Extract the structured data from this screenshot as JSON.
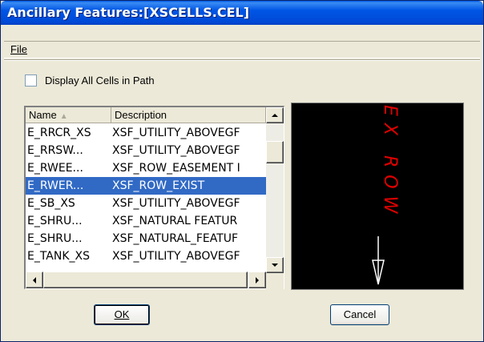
{
  "window": {
    "title": "Ancillary Features:[XSCELLS.CEL]"
  },
  "menu": {
    "file_label": "File"
  },
  "options": {
    "display_all_label": "Display All Cells in Path",
    "display_all_checked": false
  },
  "list": {
    "columns": [
      "Name",
      "Description"
    ],
    "sort_indicator": "▲",
    "rows": [
      {
        "name": "E_RRCR_XS",
        "desc": "XSF_UTILITY_ABOVEGF",
        "selected": false
      },
      {
        "name": "E_RRSW...",
        "desc": "XSF_UTILITY_ABOVEGF",
        "selected": false
      },
      {
        "name": "E_RWEE...",
        "desc": "XSF_ROW_EASEMENT I",
        "selected": false
      },
      {
        "name": "E_RWER...",
        "desc": "XSF_ROW_EXIST",
        "selected": true
      },
      {
        "name": "E_SB_XS",
        "desc": "XSF_UTILITY_ABOVEGF",
        "selected": false
      },
      {
        "name": "E_SHRU...",
        "desc": "XSF_NATURAL FEATUR",
        "selected": false
      },
      {
        "name": "E_SHRU...",
        "desc": "XSF_NATURAL_FEATUF",
        "selected": false
      },
      {
        "name": "E_TANK_XS",
        "desc": "XSF_UTILITY_ABOVEGF",
        "selected": false
      }
    ]
  },
  "preview": {
    "text": "EX ROW",
    "color": "#e00000"
  },
  "buttons": {
    "ok": "OK",
    "cancel": "Cancel"
  },
  "colors": {
    "titlebar": "#0055e5",
    "selection": "#316ac5",
    "dialog_bg": "#ece9d8"
  }
}
